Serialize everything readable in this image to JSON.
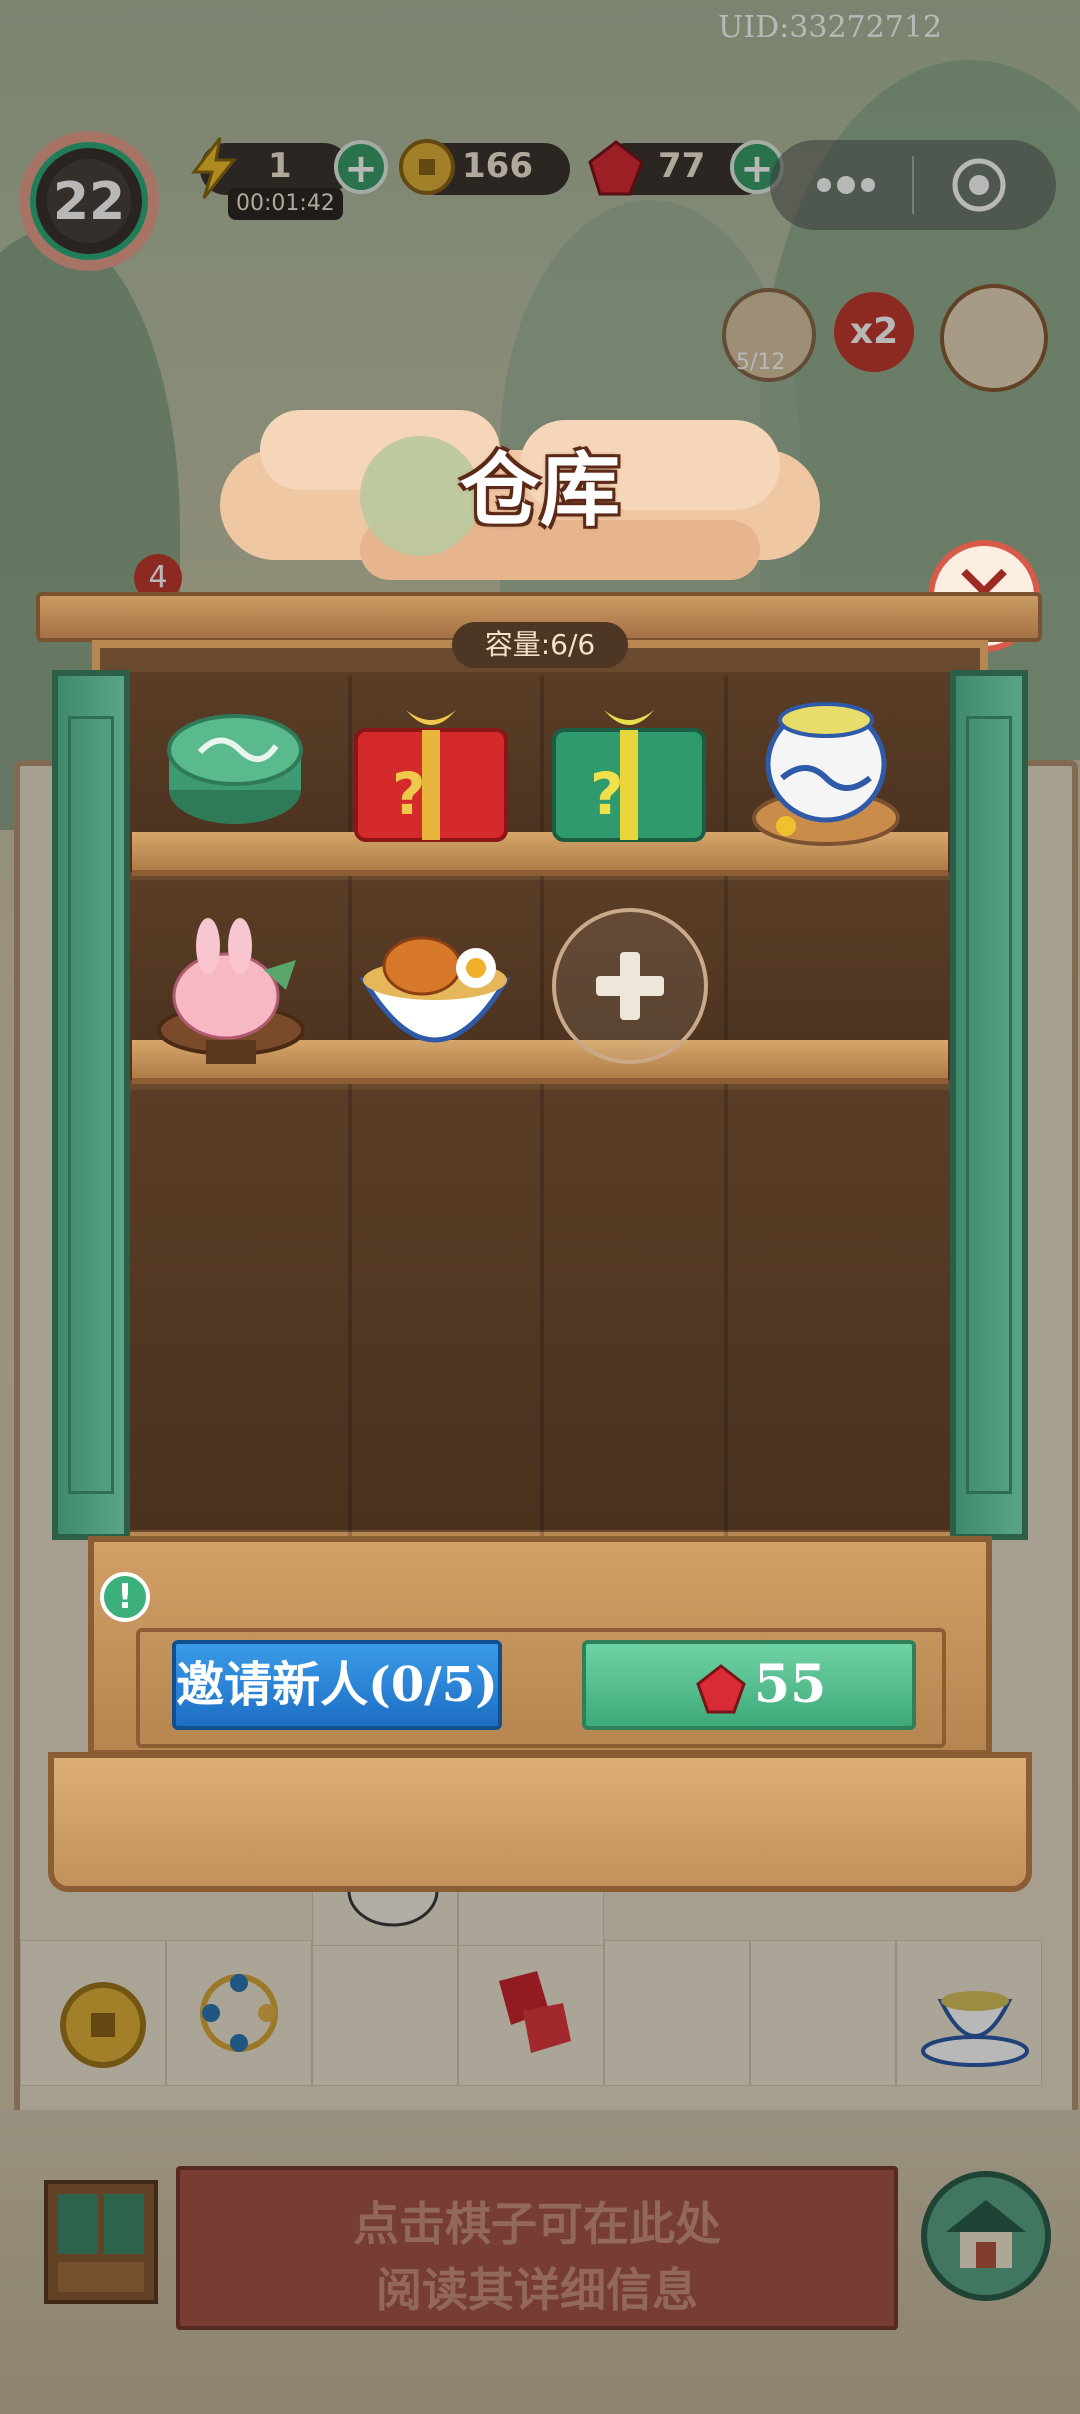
{
  "uid": "UID:33272712",
  "hud": {
    "level": "22",
    "energy": "1",
    "energy_timer": "00:01:42",
    "coins": "166",
    "gems": "77"
  },
  "side": {
    "collection_progress": "5/12",
    "multiplier": "x2",
    "notification_count": "4"
  },
  "warehouse": {
    "title": "仓库",
    "capacity": "容量:6/6",
    "items": [
      {
        "icon": "jade-coin-box-icon"
      },
      {
        "icon": "red-mystery-gift-icon"
      },
      {
        "icon": "green-mystery-gift-icon"
      },
      {
        "icon": "porcelain-tea-jar-icon"
      },
      {
        "icon": "bunny-peach-bun-icon"
      },
      {
        "icon": "roast-chicken-rice-bowl-icon"
      }
    ],
    "add_slot_icon": "plus-icon",
    "invite_label": "邀请新人(0/5)",
    "buy_price": "55"
  },
  "hint": {
    "line1": "点击棋子可在此处",
    "line2": "阅读其详细信息"
  },
  "colors": {
    "door_green": "#4f9a7a",
    "wood": "#c99a62",
    "invite_blue": "#2a85d8",
    "buy_green": "#52c08f",
    "gem_red": "#d92b35"
  }
}
